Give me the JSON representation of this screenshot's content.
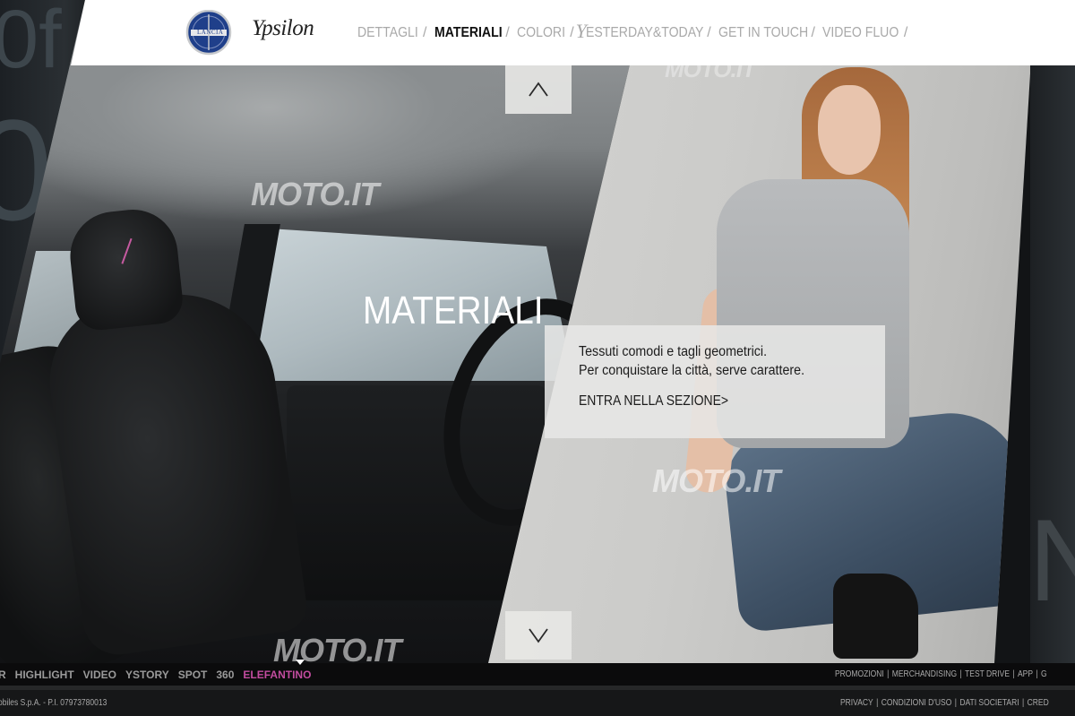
{
  "header": {
    "brand_logo_text": "LANCIA",
    "model_logo_text": "Ypsilon",
    "nav": [
      {
        "label": "DETTAGLI",
        "active": false
      },
      {
        "label": "MATERIALI",
        "active": true
      },
      {
        "label": "COLORI",
        "active": false
      },
      {
        "label": "ESTERDAY&TODAY",
        "active": false
      },
      {
        "label": "GET IN TOUCH",
        "active": false
      },
      {
        "label": "VIDEO FLUO",
        "active": false
      }
    ],
    "separator": "/"
  },
  "hero": {
    "title": "MATERIALI",
    "watermark": "MOTO.IT",
    "background_letters": [
      "0f",
      "0",
      "N"
    ],
    "info": {
      "line1": "Tessuti comodi e tagli geometrici.",
      "line2": "Per conquistare la città, serve carattere.",
      "link": "ENTRA NELLA SEZIONE>"
    },
    "arrow_up": "∧",
    "arrow_down": "∨"
  },
  "footer": {
    "nav": [
      {
        "label": "R",
        "active": false
      },
      {
        "label": "HIGHLIGHT",
        "active": false
      },
      {
        "label": "VIDEO",
        "active": false
      },
      {
        "label": "YSTORY",
        "active": false
      },
      {
        "label": "SPOT",
        "active": false
      },
      {
        "label": "360",
        "active": false
      },
      {
        "label": "ELEFANTINO",
        "active": true
      }
    ],
    "right_links_top": [
      "PROMOZIONI",
      "MERCHANDISING",
      "TEST DRIVE",
      "APP",
      "G"
    ],
    "copyright": "obiles S.p.A. - P.I. 07973780013",
    "right_links_bottom": [
      "PRIVACY",
      "CONDIZIONI D'USO",
      "DATI SOCIETARI",
      "CRED"
    ],
    "link_separator": "|"
  },
  "colors": {
    "accent": "#c24c9f",
    "nav_inactive": "#a9a9a9",
    "nav_active": "#111111"
  }
}
